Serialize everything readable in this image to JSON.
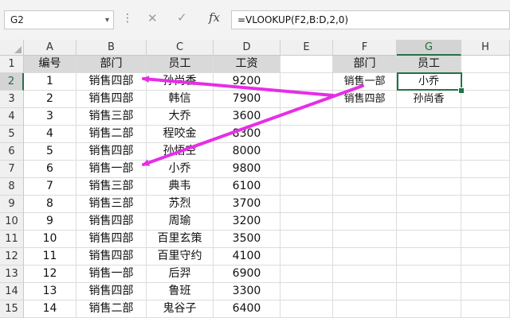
{
  "name_box": {
    "value": "G2"
  },
  "formula": {
    "text": "=VLOOKUP(F2,B:D,2,0)",
    "fx_label": "fx",
    "cancel_glyph": "✕",
    "enter_glyph": "✓",
    "options_glyph": "⋮",
    "dropdown_glyph": "▾"
  },
  "columns": [
    "A",
    "B",
    "C",
    "D",
    "E",
    "F",
    "G",
    "H"
  ],
  "rows": [
    "1",
    "2",
    "3",
    "4",
    "5",
    "6",
    "7",
    "8",
    "9",
    "10",
    "11",
    "12",
    "13",
    "14",
    "15"
  ],
  "header": {
    "a": "编号",
    "b": "部门",
    "c": "员工",
    "d": "工资",
    "f": "部门",
    "g": "员工"
  },
  "table": [
    {
      "id": "1",
      "dept": "销售四部",
      "name": "孙尚香",
      "salary": "9200"
    },
    {
      "id": "2",
      "dept": "销售四部",
      "name": "韩信",
      "salary": "7900"
    },
    {
      "id": "3",
      "dept": "销售三部",
      "name": "大乔",
      "salary": "3600"
    },
    {
      "id": "4",
      "dept": "销售二部",
      "name": "程咬金",
      "salary": "8300"
    },
    {
      "id": "5",
      "dept": "销售四部",
      "name": "孙悟空",
      "salary": "8000"
    },
    {
      "id": "6",
      "dept": "销售一部",
      "name": "小乔",
      "salary": "9800"
    },
    {
      "id": "7",
      "dept": "销售三部",
      "name": "典韦",
      "salary": "6100"
    },
    {
      "id": "8",
      "dept": "销售三部",
      "name": "苏烈",
      "salary": "3700"
    },
    {
      "id": "9",
      "dept": "销售四部",
      "name": "周瑜",
      "salary": "3200"
    },
    {
      "id": "10",
      "dept": "销售四部",
      "name": "百里玄策",
      "salary": "3500"
    },
    {
      "id": "11",
      "dept": "销售四部",
      "name": "百里守约",
      "salary": "4100"
    },
    {
      "id": "12",
      "dept": "销售一部",
      "name": "后羿",
      "salary": "6900"
    },
    {
      "id": "13",
      "dept": "销售四部",
      "name": "鲁班",
      "salary": "3300"
    },
    {
      "id": "14",
      "dept": "销售二部",
      "name": "鬼谷子",
      "salary": "6400"
    }
  ],
  "lookup": [
    {
      "dept": "销售一部",
      "name": "小乔"
    },
    {
      "dept": "销售四部",
      "name": "孙尚香"
    }
  ],
  "colors": {
    "header_fill": "#d9d9d9",
    "selection_green": "#217346",
    "arrow_magenta": "#e62ee6"
  }
}
